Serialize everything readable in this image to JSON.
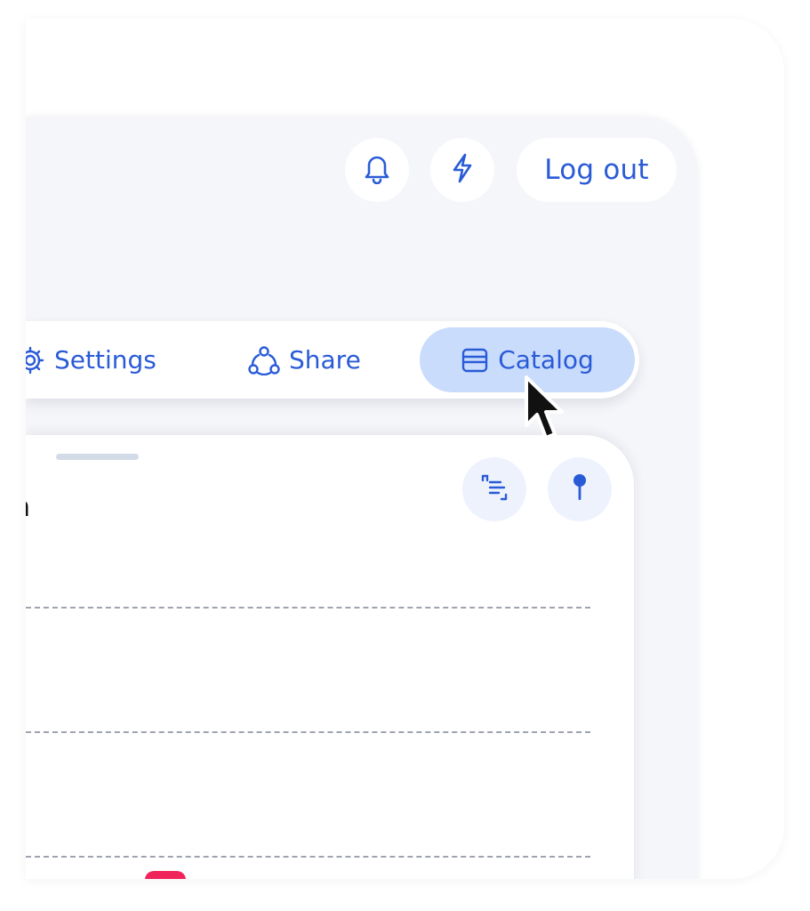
{
  "header": {
    "logout_label": "Log out",
    "icons": [
      "bell-icon",
      "bolt-icon"
    ]
  },
  "tabs": [
    {
      "label": "Settings",
      "icon": "gear-icon"
    },
    {
      "label": "Share",
      "icon": "share-icon"
    },
    {
      "label": "Catalog",
      "icon": "catalog-icon",
      "active": true
    }
  ],
  "sheet": {
    "title": "n",
    "icons": [
      "list-icon",
      "pin-icon"
    ]
  },
  "colors": {
    "accent": "#2a5bd7",
    "active_tab_bg": "#c9dcfb",
    "panel_bg": "#f5f6fa",
    "badge": "#f0245b"
  }
}
